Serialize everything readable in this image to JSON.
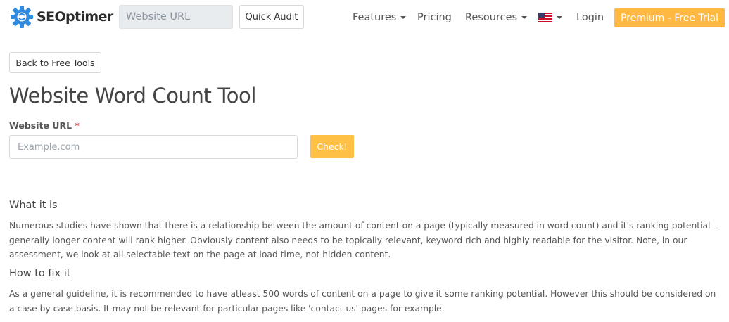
{
  "header": {
    "brand_name": "SEOptimer",
    "logo_icon": "seoptimer-gear-logo",
    "url_placeholder": "Website URL",
    "quick_audit_label": "Quick Audit",
    "nav": {
      "features_label": "Features",
      "pricing_label": "Pricing",
      "resources_label": "Resources",
      "language_flag": "us-flag-icon",
      "login_label": "Login"
    },
    "premium_label": "Premium - Free Trial"
  },
  "main": {
    "back_label": "Back to Free Tools",
    "title": "Website Word Count Tool",
    "form": {
      "label": "Website URL",
      "required_mark": "*",
      "placeholder": "Example.com",
      "value": "",
      "submit_label": "Check!"
    },
    "sections": [
      {
        "heading": "What it is",
        "body": "Numerous studies have shown that there is a relationship between the amount of content on a page (typically measured in word count) and it's ranking potential - generally longer content will rank higher. Obviously content also needs to be topically relevant, keyword rich and highly readable for the visitor. Note, in our assessment, we look at all selectable text on the page at load time, not hidden content."
      },
      {
        "heading": "How to fix it",
        "body": "As a general guideline, it is recommended to have atleast 500 words of content on a page to give it some ranking potential. However this should be considered on a case by case basis. It may not be relevant for particular pages like 'contact us' pages for example."
      }
    ]
  },
  "colors": {
    "accent_orange": "#ffb942",
    "check_button": "#ffc046",
    "logo_blue": "#2f8ae0",
    "required_red": "#d9534f",
    "text_dark": "#444444"
  }
}
